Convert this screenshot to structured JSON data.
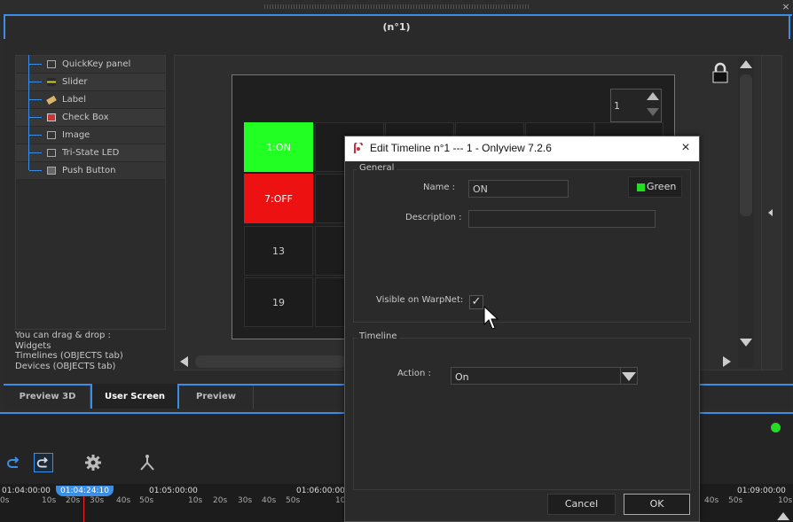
{
  "window": {
    "title": "(n°1)",
    "close_glyph": "×"
  },
  "widgets": {
    "items": [
      {
        "label": "QuickKey panel",
        "icon": "panel-icon"
      },
      {
        "label": "Slider",
        "icon": "slider-icon"
      },
      {
        "label": "Label",
        "icon": "label-icon"
      },
      {
        "label": "Check Box",
        "icon": "checkbox-icon"
      },
      {
        "label": "Image",
        "icon": "image-icon"
      },
      {
        "label": "Tri-State LED",
        "icon": "led-icon"
      },
      {
        "label": "Push Button",
        "icon": "push-button-icon"
      }
    ],
    "hint_lines": [
      "You can drag & drop :",
      "Widgets",
      "Timelines (OBJECTS tab)",
      "Devices (OBJECTS tab)"
    ]
  },
  "preview": {
    "spinner_value": "1",
    "pads": [
      "1:ON",
      "7:OFF",
      "13",
      "19"
    ],
    "pad_colors": {
      "on": "#22ff22",
      "off": "#ee1111"
    }
  },
  "tabs": [
    {
      "label": "Preview 3D",
      "active": false
    },
    {
      "label": "User Screen",
      "active": true
    },
    {
      "label": "Preview",
      "active": false
    }
  ],
  "timeline": {
    "current": "01:04:24:10",
    "timecodes": [
      "01:04:00:00",
      "01:05:00:00",
      "01:06:00:00",
      "01:09:00:00"
    ],
    "seconds_left": [
      "0s",
      "10s",
      "20s",
      "30s",
      "40s",
      "50s",
      "10s",
      "20s",
      "30s",
      "40s",
      "50s",
      "10"
    ],
    "seconds_right": [
      "40s",
      "50s",
      "10s"
    ],
    "status_color": "#22dd22"
  },
  "dialog": {
    "title": "Edit Timeline n°1 --- 1 - Onlyview  7.2.6",
    "general_label": "General",
    "name_label": "Name :",
    "name_value": "ON",
    "color_label": "Green",
    "color_value": "#22dd22",
    "description_label": "Description :",
    "description_value": "",
    "visible_label": "Visible on WarpNet:",
    "visible_checked": true,
    "check_glyph": "✓",
    "timeline_label": "Timeline",
    "action_label": "Action :",
    "action_value": "On",
    "cancel_label": "Cancel",
    "ok_label": "OK"
  }
}
